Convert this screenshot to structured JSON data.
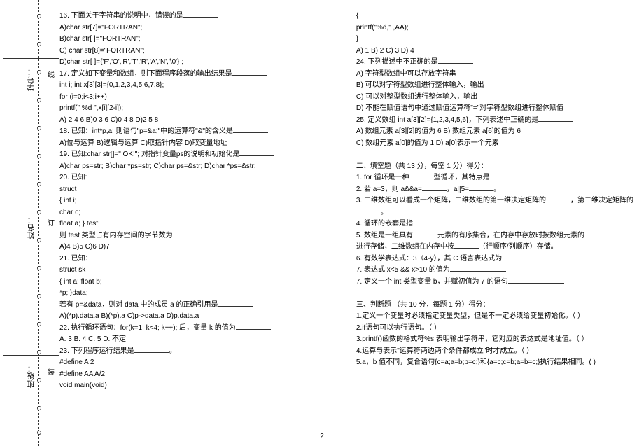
{
  "sidebar": {
    "labels": [
      "学号：",
      "姓名：",
      "班级："
    ]
  },
  "margin_chars": [
    "线",
    "订",
    "装"
  ],
  "pagenum": "2",
  "left": {
    "q16": "16. 下面关于字符串的说明中，错误的是",
    "q16a": "A)char str[7]=\"FORTRAN\";",
    "q16b": "B)char str[ ]=\"FORTRAN\";",
    "q16c": "C) char str[8]=\"FORTRAN\";",
    "q16d": "D)char str[ ]={'F','O','R','T','R','A','N','\\0'} ;",
    "q17": "17. 定义如下变量和数组，则下面程序段落的输出结果是",
    "q17l1": "int i; int x[3][3]={0,1,2,3,4,5,6,7,8};",
    "q17l2": "for (i=0;i<3;i++)",
    "q17l3": "printf(\" %d \",x[i][2-i]);",
    "q17a": "A) 2 4 6        B)0 3 6        C)0 4 8        D)2 5 8",
    "q18": "18. 已知：int*p,a; 则语句\"p=&a;\"中的运算符\"&\"的含义是",
    "q18a": "A)位与运算      B)逻辑与运算      C)取指针内容      D)取变量地址",
    "q19": "19. 已知:char str[]=\" OK!\"; 对指针变量ps的说明和初始化是",
    "q19a": "A)char ps=str;    B)char *ps=str;    C)char ps=&str;    D)char *ps=&str;",
    "q20": "20. 已知:",
    "q20l1": "struct",
    "q20l2": "{    int i;",
    "q20l3": "      char c;",
    "q20l4": "      float a; } test;",
    "q20l5": "则 test 类型占有内存空间的字节数为",
    "q20a": "A)4    B)5     C)6    D)7",
    "q21": "21. 已知：",
    "q21l1": "     struct sk",
    "q21l2": "  {   int a;     float b;",
    "q21l3": "            *p; }data;",
    "q21l4": "若有 p=&data，则对 data 中的成员 a 的正确引用是",
    "q21a": "A)(*p).data.a     B)(*p).a    C)p->data.a     D)p.data.a",
    "q22": "22. 执行循环语句：for(k=1; k<4; k++); 后，变量 k 的值为",
    "q22a": "A.  3      B.  4     C. 5       D. 不定",
    "q23": "23. 下列程序运行结果是",
    "q23l1": "#define  A  2",
    "q23l2": "#define  AA  A/2",
    "q23l3": "void main(void)"
  },
  "right": {
    "r1": "{",
    "r2": "   printf(\"%d,\" ,AA);",
    "r3": "   }",
    "r4": "A) 1        B) 2        C) 3         D) 4",
    "q24": "24. 下列描述中不正确的是",
    "q24a": "A) 字符型数组中可以存放字符串",
    "q24b": "B) 可以对字符型数组进行整体输入，输出",
    "q24c": "C) 可以对整型数组进行整体输入，输出",
    "q24d": "D) 不能在赋值语句中通过赋值运算符\"=\"对字符型数组进行整体赋值",
    "q25": "25.    定义数组 int a[3][2]={1,2,3,4,5,6}，下列表述中正确的是",
    "q25a": "A)  数组元素 a[3][2]的值为 6          B)  数组元素 a[6]的值为 6",
    "q25c": "C)  数组元素 a[0]的值为 1           D)  a[0]表示一个元素",
    "sec2": "二、填空题（共 13 分，每空 1 分）得分：",
    "f1a": "1.   for 循环是一种",
    "f1b": "型循环，其特点是",
    "f2a": "2. 若 a=3，则 a&&a=",
    "f2b": "，a||5=",
    "f2c": "。",
    "f3a": "3. 二维数组可以看成一个矩阵，二维数组的第一维决定矩阵的",
    "f3b": "，第二维决定矩阵的",
    "f3c": "。",
    "f4": "4. 循环的嵌套是指",
    "f5a": "5. 数组是一组具有",
    "f5b": "元素的有序集合，在内存中存放时按数组元素的",
    "f5c": "进行存储，二维数组在内存中按",
    "f5d": "（行顺序/列顺序）存储。",
    "f6a": "6. 有数学表达式：3（4-y），其 C 语言表达式为",
    "f7a": "7. 表达式 x<5 && x>10  的值为",
    "f8a": "7.   定义一个 int 类型变量 b，并赋初值为 7 的语句",
    "sec3": "三、判断题 （共 10 分，每题 1 分）得分：",
    "j1": "1.定义一个变量时必须指定变量类型，但是不一定必须给变量初始化。（    ）",
    "j2": "2.if语句可以执行语句。（    ）",
    "j3": "3.printf()函数的格式符%s 表明输出字符串，它对应的表达式是地址值。（    ）",
    "j4": "4.运算与表示\"运算符两边两个条件都成立\"时才成立。（    ）",
    "j5": "5.a，b 值不同，复合语句{c=a;a=b;b=c;}和{a=c;c=b;a=b=c;}执行结果相同。(     )"
  }
}
